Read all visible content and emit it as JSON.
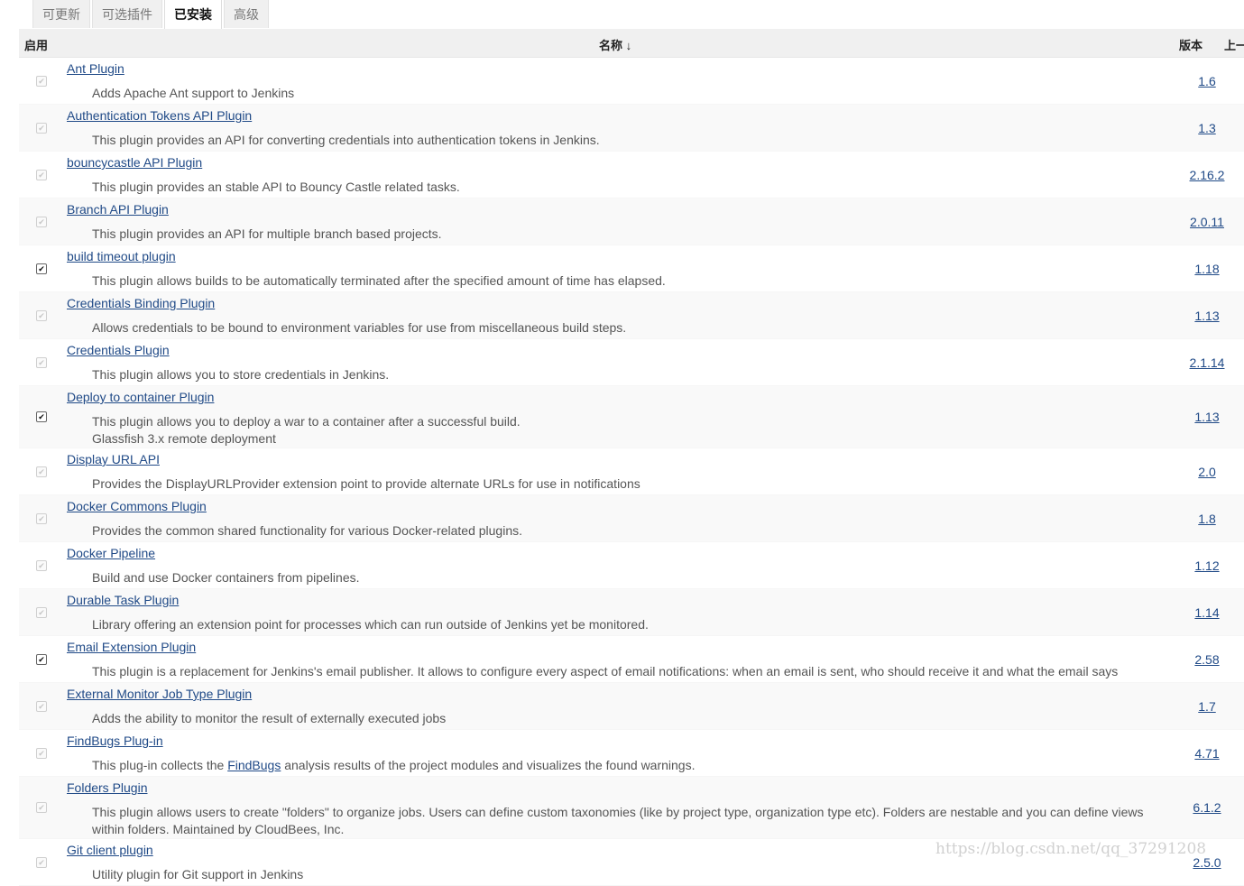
{
  "tabs": [
    "可更新",
    "可选插件",
    "已安装",
    "高级"
  ],
  "header": {
    "enabled": "启用",
    "name": "名称 ↓",
    "version": "版本",
    "previous": "上一"
  },
  "plugins": [
    {
      "name": "Ant Plugin",
      "desc": "Adds Apache Ant support to Jenkins",
      "version": "1.6",
      "checked": false
    },
    {
      "name": "Authentication Tokens API Plugin",
      "desc": "This plugin provides an API for converting credentials into authentication tokens in Jenkins.",
      "version": "1.3",
      "checked": false
    },
    {
      "name": "bouncycastle API Plugin",
      "desc": "This plugin provides an stable API to Bouncy Castle related tasks.",
      "version": "2.16.2",
      "checked": false
    },
    {
      "name": "Branch API Plugin",
      "desc": "This plugin provides an API for multiple branch based projects.",
      "version": "2.0.11",
      "checked": false
    },
    {
      "name": "build timeout plugin",
      "desc": "This plugin allows builds to be automatically terminated after the specified amount of time has elapsed.",
      "version": "1.18",
      "checked": true
    },
    {
      "name": "Credentials Binding Plugin",
      "desc": "Allows credentials to be bound to environment variables for use from miscellaneous build steps.",
      "version": "1.13",
      "checked": false
    },
    {
      "name": "Credentials Plugin",
      "desc": "This plugin allows you to store credentials in Jenkins.",
      "version": "2.1.14",
      "checked": false
    },
    {
      "name": "Deploy to container Plugin",
      "desc": "This plugin allows you to deploy a war to a container after a successful build.",
      "desc2": "Glassfish 3.x remote deployment",
      "version": "1.13",
      "checked": true
    },
    {
      "name": "Display URL API",
      "desc": "Provides the DisplayURLProvider extension point to provide alternate URLs for use in notifications",
      "version": "2.0",
      "checked": false
    },
    {
      "name": "Docker Commons Plugin",
      "desc": "Provides the common shared functionality for various Docker-related plugins.",
      "version": "1.8",
      "checked": false
    },
    {
      "name": "Docker Pipeline",
      "desc": "Build and use Docker containers from pipelines.",
      "version": "1.12",
      "checked": false
    },
    {
      "name": "Durable Task Plugin",
      "desc": "Library offering an extension point for processes which can run outside of Jenkins yet be monitored.",
      "version": "1.14",
      "checked": false
    },
    {
      "name": "Email Extension Plugin",
      "desc": "This plugin is a replacement for Jenkins's email publisher. It allows to configure every aspect of email notifications: when an email is sent, who should receive it and what the email says",
      "version": "2.58",
      "checked": true
    },
    {
      "name": "External Monitor Job Type Plugin",
      "desc": "Adds the ability to monitor the result of externally executed jobs",
      "version": "1.7",
      "checked": false
    },
    {
      "name": "FindBugs Plug-in",
      "desc_pre": "This plug-in collects the ",
      "desc_link": "FindBugs",
      "desc_post": " analysis results of the project modules and visualizes the found warnings.",
      "version": "4.71",
      "checked": false
    },
    {
      "name": "Folders Plugin",
      "desc": "This plugin allows users to create \"folders\" to organize jobs. Users can define custom taxonomies (like by project type, organization type etc). Folders are nestable and you can define views within folders. Maintained by CloudBees, Inc.",
      "version": "6.1.2",
      "checked": false
    },
    {
      "name": "Git client plugin",
      "desc": "Utility plugin for Git support in Jenkins",
      "version": "2.5.0",
      "checked": false
    }
  ],
  "watermark": "https://blog.csdn.net/qq_37291208"
}
